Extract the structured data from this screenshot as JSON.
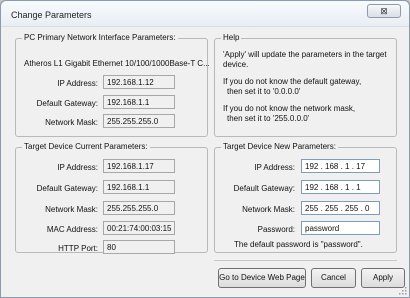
{
  "window": {
    "title": "Change Parameters",
    "close_glyph": "⊠"
  },
  "pc": {
    "legend": "PC Primary Network Interface Parameters:",
    "adapter": "Atheros L1 Gigabit Ethernet 10/100/1000Base-T C...",
    "ip_label": "IP Address:",
    "ip_value": "192.168.1.12",
    "gw_label": "Default Gateway:",
    "gw_value": "192.168.1.1",
    "mask_label": "Network Mask:",
    "mask_value": "255.255.255.0"
  },
  "help": {
    "legend": "Help",
    "line1": "'Apply' will update the parameters in the target",
    "line2": "device.",
    "line3": "If you do not know the default gateway,",
    "line4": "then set it to '0.0.0.0'",
    "line5": "If you do not know the network mask,",
    "line6": "then set it to '255.0.0.0'"
  },
  "current": {
    "legend": "Target Device Current Parameters:",
    "ip_label": "IP Address:",
    "ip_value": "192.168.1.17",
    "gw_label": "Default Gateway:",
    "gw_value": "192.168.1.1",
    "mask_label": "Network Mask:",
    "mask_value": "255.255.255.0",
    "mac_label": "MAC Address:",
    "mac_value": "00:21:74:00:03:15",
    "port_label": "HTTP Port:",
    "port_value": "80"
  },
  "new": {
    "legend": "Target Device New Parameters:",
    "ip_label": "IP Address:",
    "ip_value": "192 . 168 . 1 . 17",
    "gw_label": "Default Gateway:",
    "gw_value": "192 . 168 . 1 . 1",
    "mask_label": "Network Mask:",
    "mask_value": "255 . 255 . 255 . 0",
    "pw_label": "Password:",
    "pw_value": "password",
    "pw_note": "The default password is \"password\"."
  },
  "buttons": {
    "web": "Go to Device Web Page",
    "cancel": "Cancel",
    "apply": "Apply"
  }
}
